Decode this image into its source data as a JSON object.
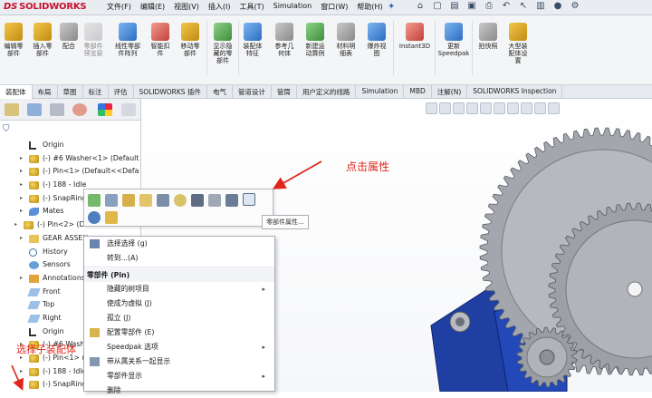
{
  "app": {
    "logo_prefix": "DS",
    "logo_text": "SOLIDWORKS"
  },
  "menu": [
    "文件(F)",
    "编辑(E)",
    "视图(V)",
    "插入(I)",
    "工具(T)",
    "Simulation",
    "窗口(W)",
    "帮助(H)"
  ],
  "quick_access": [
    "home-icon",
    "new-icon",
    "open-icon",
    "save-icon",
    "print-icon",
    "undo-icon",
    "select-icon",
    "rebuild-icon",
    "traffic-light-icon",
    "options-icon"
  ],
  "ribbon": {
    "commands": [
      {
        "label": "编辑零\n部件",
        "icon": "edit-component-icon"
      },
      {
        "label": "插入零\n部件",
        "icon": "insert-component-icon"
      },
      {
        "label": "配合",
        "icon": "mate-icon"
      },
      {
        "label": "零部件\n预览窗",
        "icon": "component-preview-icon",
        "disabled": true
      },
      {
        "label": "线性零部\n件阵列",
        "icon": "linear-pattern-icon"
      },
      {
        "label": "智能扣\n件",
        "icon": "smart-fastener-icon"
      },
      {
        "label": "移动零\n部件",
        "icon": "move-component-icon"
      },
      {
        "label": "显示隐\n藏的零\n部件",
        "icon": "show-hidden-icon"
      },
      {
        "label": "装配体\n特征",
        "icon": "assembly-feature-icon"
      },
      {
        "label": "参考几\n何体",
        "icon": "reference-geometry-icon"
      },
      {
        "label": "新建运\n动算例",
        "icon": "motion-study-icon"
      },
      {
        "label": "材料明\n细表",
        "icon": "bom-icon"
      },
      {
        "label": "爆炸视\n图",
        "icon": "exploded-view-icon"
      },
      {
        "label": "Instant3D",
        "icon": "instant3d-icon"
      },
      {
        "label": "更新\nSpeedpak",
        "icon": "speedpak-icon"
      },
      {
        "label": "拍快照",
        "icon": "snapshot-icon"
      },
      {
        "label": "大型装\n配体设\n置",
        "icon": "large-assembly-icon"
      }
    ]
  },
  "tabs": [
    "装配体",
    "布局",
    "草图",
    "标注",
    "评估",
    "SOLIDWORKS 插件",
    "电气",
    "管道设计",
    "管筒",
    "用户定义的线路",
    "Simulation",
    "MBD",
    "注解(N)",
    "SOLIDWORKS Inspection"
  ],
  "tree": [
    {
      "indent": 1,
      "icon": "origin",
      "text": "Origin",
      "expand": false
    },
    {
      "indent": 1,
      "icon": "gold",
      "text": "(-) #6 Washer<1> (Default",
      "expand": true
    },
    {
      "indent": 1,
      "icon": "gold",
      "text": "(-) Pin<1> (Default<<Defa",
      "expand": true
    },
    {
      "indent": 1,
      "icon": "gold",
      "text": "(-) 188 - Idle",
      "expand": true
    },
    {
      "indent": 1,
      "icon": "gold",
      "text": "(-) SnapRing",
      "expand": true
    },
    {
      "indent": 1,
      "icon": "mate",
      "text": "Mates",
      "expand": true
    },
    {
      "indent": 0,
      "icon": "gold",
      "text": "(-) Pin<2> (Default<Default Di",
      "expand": true
    },
    {
      "indent": 1,
      "icon": "folder",
      "text": "GEAR ASSEN",
      "expand": true
    },
    {
      "indent": 1,
      "icon": "hist",
      "text": "History",
      "expand": false
    },
    {
      "indent": 1,
      "icon": "sensor",
      "text": "Sensors",
      "expand": false
    },
    {
      "indent": 1,
      "icon": "anno",
      "text": "Annotations",
      "expand": true
    },
    {
      "indent": 1,
      "icon": "plane",
      "text": "Front",
      "expand": false
    },
    {
      "indent": 1,
      "icon": "plane",
      "text": "Top",
      "expand": false
    },
    {
      "indent": 1,
      "icon": "plane",
      "text": "Right",
      "expand": false
    },
    {
      "indent": 1,
      "icon": "origin",
      "text": "Origin",
      "expand": false
    },
    {
      "indent": 1,
      "icon": "gold",
      "text": "(-) #6 Washe",
      "expand": true
    },
    {
      "indent": 1,
      "icon": "gold",
      "text": "(-) Pin<1> (D",
      "expand": true
    },
    {
      "indent": 1,
      "icon": "gold",
      "text": "(-) 188 - Idle",
      "expand": true
    },
    {
      "indent": 1,
      "icon": "gold",
      "text": "(-) SnapRing",
      "expand": true
    }
  ],
  "context_toolbar": {
    "tooltip": "零部件属性..."
  },
  "context_menu": {
    "top_items": [
      {
        "label": "选择选择 (g)",
        "icon": "select-icon"
      },
      {
        "label": "转到...(A)",
        "icon": ""
      }
    ],
    "header": "零部件 (Pin)",
    "items": [
      {
        "label": "隐藏的树项目",
        "submenu": true
      },
      {
        "label": "使成为虚拟 (J)",
        "submenu": false
      },
      {
        "label": "孤立 (J)",
        "submenu": false
      },
      {
        "label": "配置零部件 (E)",
        "submenu": false,
        "icon": "config-icon"
      },
      {
        "label": "Speedpak 选项",
        "submenu": true
      },
      {
        "label": "带从属关系一起显示",
        "submenu": false,
        "icon": "show-with-dependents-icon"
      },
      {
        "label": "零部件显示",
        "submenu": true
      },
      {
        "label": "删除",
        "submenu": false
      }
    ]
  },
  "annotations": {
    "properties_hint": "点击属性",
    "select_subassembly_hint": "选择子装配体"
  }
}
